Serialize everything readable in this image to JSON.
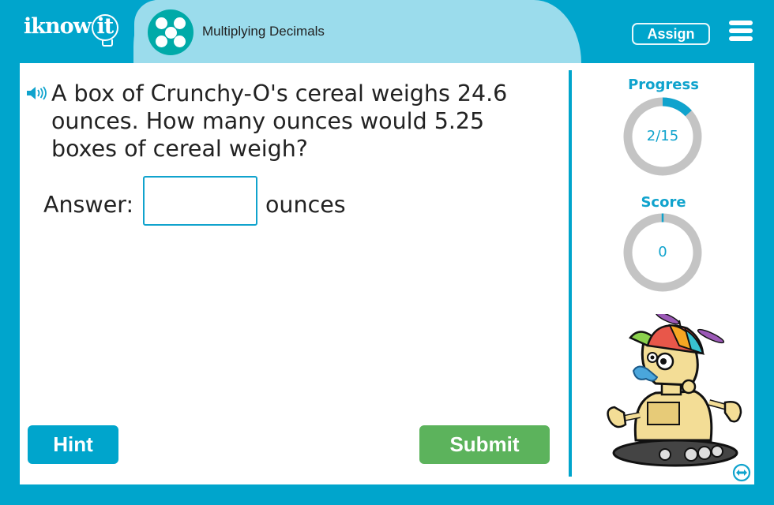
{
  "header": {
    "logo_text": "iknow",
    "logo_bulb_text": "it",
    "lesson_icon": "dice-five-icon",
    "lesson_title": "Multiplying Decimals",
    "assign_label": "Assign",
    "menu_icon": "hamburger-menu-icon"
  },
  "question": {
    "audio_icon": "speaker-icon",
    "text": "A box of Crunchy-O's cereal weighs 24.6 ounces. How many ounces would 5.25 boxes of cereal weigh?",
    "answer_label": "Answer:",
    "answer_value": "",
    "answer_placeholder": "",
    "answer_unit": "ounces"
  },
  "buttons": {
    "hint_label": "Hint",
    "submit_label": "Submit"
  },
  "sidebar": {
    "progress_label": "Progress",
    "progress_text": "2/15",
    "progress_current": 2,
    "progress_total": 15,
    "score_label": "Score",
    "score_text": "0",
    "score_value": 0,
    "mascot": "robot-mascot-with-propeller-cap",
    "expand_icon": "expand-horizontal-icon"
  },
  "colors": {
    "brand": "#00a5cc",
    "title_tab": "#9bdcec",
    "lesson_icon_bg": "#00aaa8",
    "submit": "#5cb35c",
    "ring_track": "#c4c4c4",
    "ring_fill": "#10a3cd"
  }
}
